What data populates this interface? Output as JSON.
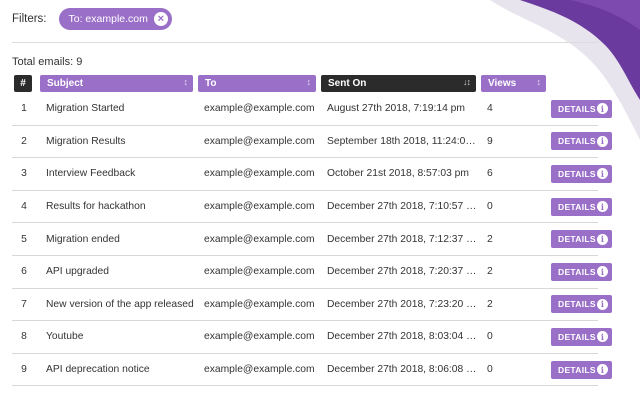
{
  "colors": {
    "accent": "#9a6fc8",
    "header_dark": "#2b2b2b",
    "swoosh": "#6b3a9e"
  },
  "filters": {
    "label": "Filters:",
    "chips": [
      {
        "label": "To: example.com",
        "close_icon": "close-icon"
      }
    ]
  },
  "summary": {
    "total_label": "Total emails: 9"
  },
  "table": {
    "columns": [
      {
        "label": "#",
        "sort_icon": ""
      },
      {
        "label": "Subject",
        "sort_icon": "sort-icon"
      },
      {
        "label": "To",
        "sort_icon": "sort-icon"
      },
      {
        "label": "Sent On",
        "sort_icon": "sort-desc-icon",
        "active": true
      },
      {
        "label": "Views",
        "sort_icon": "sort-icon"
      }
    ],
    "sort_glyph": "↕",
    "sort_active_glyph": "↓↕",
    "button_label": "DETAILS",
    "info_glyph": "i",
    "rows": [
      {
        "num": "1",
        "subject": "Migration Started",
        "to": "example@example.com",
        "sent": "August 27th 2018, 7:19:14 pm",
        "views": "4"
      },
      {
        "num": "2",
        "subject": "Migration Results",
        "to": "example@example.com",
        "sent": "September 18th 2018, 11:24:0…",
        "views": "9"
      },
      {
        "num": "3",
        "subject": "Interview Feedback",
        "to": "example@example.com",
        "sent": "October 21st 2018, 8:57:03 pm",
        "views": "6"
      },
      {
        "num": "4",
        "subject": "Results for hackathon",
        "to": "example@example.com",
        "sent": "December 27th 2018, 7:10:57 …",
        "views": "0"
      },
      {
        "num": "5",
        "subject": "Migration ended",
        "to": "example@example.com",
        "sent": "December 27th 2018, 7:12:37 …",
        "views": "2"
      },
      {
        "num": "6",
        "subject": "API upgraded",
        "to": "example@example.com",
        "sent": "December 27th 2018, 7:20:37 …",
        "views": "2"
      },
      {
        "num": "7",
        "subject": "New version of the app released",
        "to": "example@example.com",
        "sent": "December 27th 2018, 7:23:20 …",
        "views": "2"
      },
      {
        "num": "8",
        "subject": "Youtube",
        "to": "example@example.com",
        "sent": "December 27th 2018, 8:03:04 …",
        "views": "0"
      },
      {
        "num": "9",
        "subject": "API deprecation notice",
        "to": "example@example.com",
        "sent": "December 27th 2018, 8:06:08 …",
        "views": "0"
      }
    ]
  }
}
